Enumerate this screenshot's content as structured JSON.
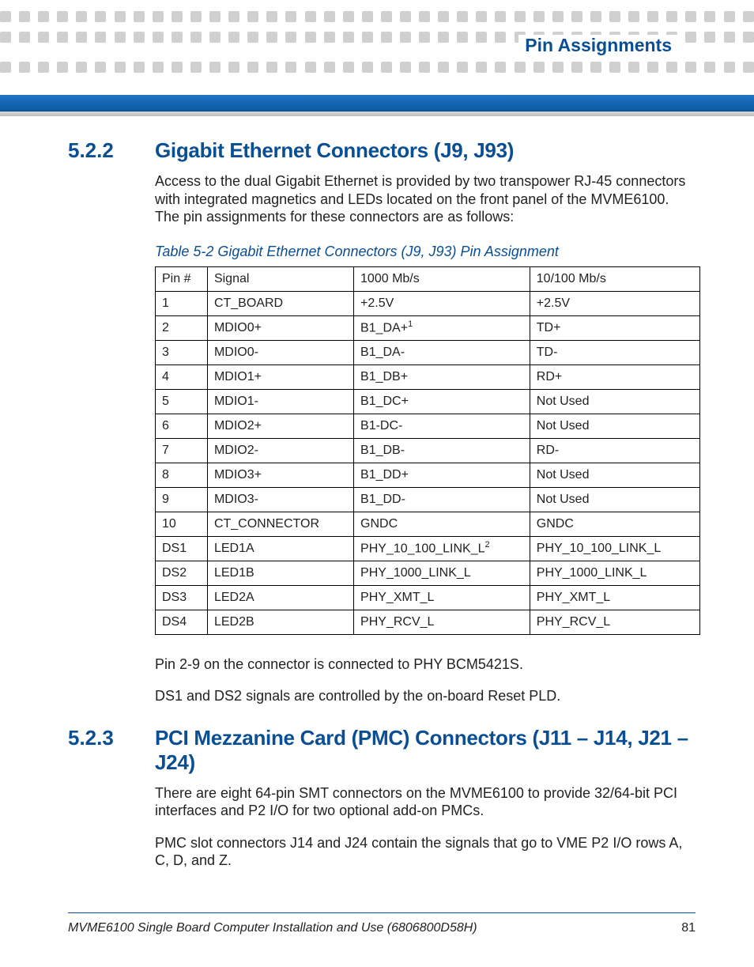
{
  "header": {
    "chapter_title": "Pin Assignments"
  },
  "section1": {
    "number": "5.2.2",
    "title": "Gigabit Ethernet Connectors (J9, J93)",
    "intro": "Access to the dual Gigabit Ethernet is provided by two transpower RJ-45 connectors with integrated magnetics and LEDs located on the front panel of the MVME6100. The pin assignments for these connectors are as follows:",
    "table_caption": "Table 5-2 Gigabit Ethernet Connectors (J9, J93) Pin Assignment",
    "columns": [
      "Pin #",
      "Signal",
      "1000 Mb/s",
      "10/100 Mb/s"
    ],
    "rows": [
      {
        "pin": "1",
        "signal": "CT_BOARD",
        "c1000": "+2.5V",
        "c10": "+2.5V",
        "sup1000": ""
      },
      {
        "pin": "2",
        "signal": "MDIO0+",
        "c1000": "B1_DA+",
        "c10": "TD+",
        "sup1000": "1"
      },
      {
        "pin": "3",
        "signal": "MDIO0-",
        "c1000": "B1_DA-",
        "c10": "TD-",
        "sup1000": ""
      },
      {
        "pin": "4",
        "signal": "MDIO1+",
        "c1000": "B1_DB+",
        "c10": "RD+",
        "sup1000": ""
      },
      {
        "pin": "5",
        "signal": "MDIO1-",
        "c1000": "B1_DC+",
        "c10": "Not Used",
        "sup1000": ""
      },
      {
        "pin": "6",
        "signal": "MDIO2+",
        "c1000": "B1-DC-",
        "c10": "Not Used",
        "sup1000": ""
      },
      {
        "pin": "7",
        "signal": "MDIO2-",
        "c1000": "B1_DB-",
        "c10": "RD-",
        "sup1000": ""
      },
      {
        "pin": "8",
        "signal": "MDIO3+",
        "c1000": "B1_DD+",
        "c10": "Not Used",
        "sup1000": ""
      },
      {
        "pin": "9",
        "signal": "MDIO3-",
        "c1000": "B1_DD-",
        "c10": "Not Used",
        "sup1000": ""
      },
      {
        "pin": "10",
        "signal": "CT_CONNECTOR",
        "c1000": "GNDC",
        "c10": "GNDC",
        "sup1000": ""
      },
      {
        "pin": "DS1",
        "signal": "LED1A",
        "c1000": "PHY_10_100_LINK_L",
        "c10": "PHY_10_100_LINK_L",
        "sup1000": "2"
      },
      {
        "pin": "DS2",
        "signal": "LED1B",
        "c1000": "PHY_1000_LINK_L",
        "c10": "PHY_1000_LINK_L",
        "sup1000": ""
      },
      {
        "pin": "DS3",
        "signal": "LED2A",
        "c1000": "PHY_XMT_L",
        "c10": "PHY_XMT_L",
        "sup1000": ""
      },
      {
        "pin": "DS4",
        "signal": "LED2B",
        "c1000": "PHY_RCV_L",
        "c10": "PHY_RCV_L",
        "sup1000": ""
      }
    ],
    "after1": "Pin 2-9 on the connector is connected to PHY BCM5421S.",
    "after2": "DS1 and DS2 signals are controlled by the on-board Reset PLD."
  },
  "section2": {
    "number": "5.2.3",
    "title": "PCI Mezzanine Card (PMC) Connectors (J11 – J14, J21 – J24)",
    "p1": "There are eight 64-pin SMT connectors on the MVME6100 to provide 32/64-bit PCI interfaces and P2 I/O for two optional add-on PMCs.",
    "p2": "PMC slot connectors J14 and J24 contain the signals that go to VME P2 I/O rows A, C, D, and Z."
  },
  "footer": {
    "text": "MVME6100 Single Board Computer Installation and Use (6806800D58H)",
    "page": "81"
  }
}
